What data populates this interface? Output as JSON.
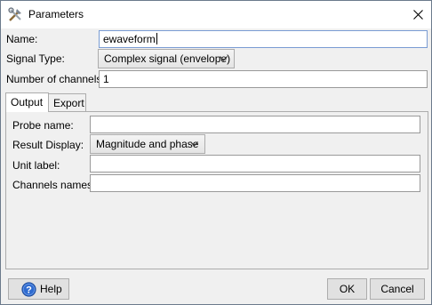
{
  "window": {
    "title": "Parameters"
  },
  "form": {
    "name_label": "Name:",
    "name_value": "ewaveform",
    "signal_type_label": "Signal Type:",
    "signal_type_value": "Complex signal (envelope)",
    "channels_label": "Number of channels:",
    "channels_value": "1"
  },
  "tabs": [
    {
      "label": "Output",
      "active": true
    },
    {
      "label": "Export",
      "active": false
    }
  ],
  "output": {
    "probe_name_label": "Probe name:",
    "probe_name_value": "",
    "result_display_label": "Result Display:",
    "result_display_value": "Magnitude and phase",
    "unit_label_label": "Unit label:",
    "unit_label_value": "",
    "channels_names_label": "Channels names:",
    "channels_names_value": ""
  },
  "buttons": {
    "help": "Help",
    "ok": "OK",
    "cancel": "Cancel"
  },
  "icons": {
    "app": "tools-icon",
    "close": "close-icon",
    "help": "help-icon",
    "dropdown": "chevron-down-icon"
  },
  "colors": {
    "help_icon": "#2f6bd0",
    "field_border": "#9a9a9a",
    "focus_border": "#7a9cd3"
  }
}
